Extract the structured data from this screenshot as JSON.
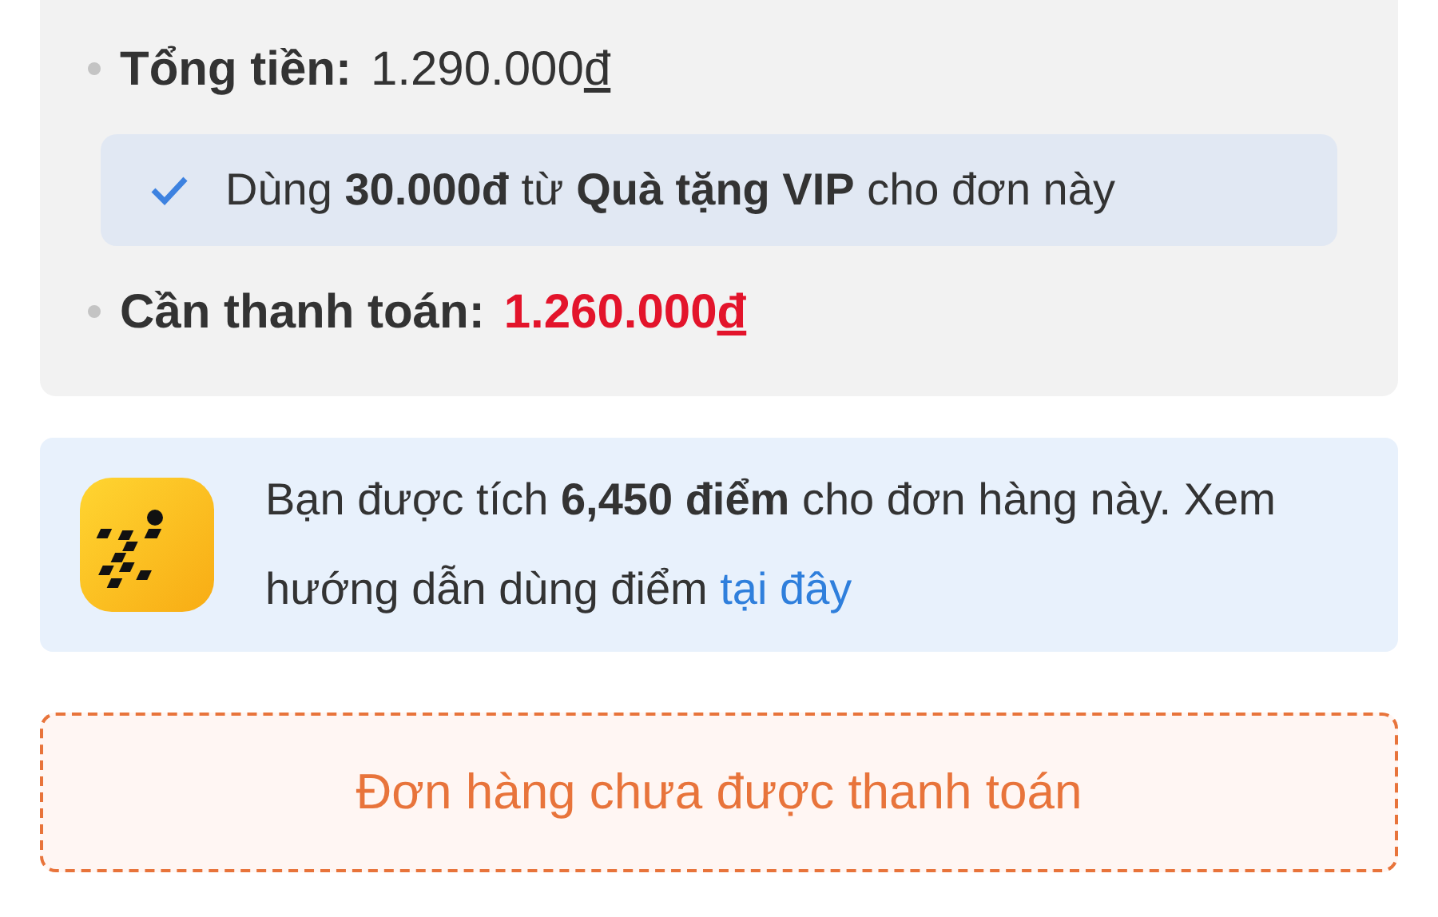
{
  "summary": {
    "total": {
      "label": "Tổng tiền:",
      "amount": "1.290.000",
      "currency": "đ"
    },
    "voucher": {
      "checked": true,
      "text": "Dùng **30.000đ** từ **Quà tặng VIP** cho đơn này"
    },
    "payable": {
      "label": "Cần thanh toán:",
      "amount": "1.260.000",
      "currency": "đ"
    }
  },
  "points": {
    "text": "Bạn được tích **6,450 điểm** cho đơn hàng này. Xem hướng dẫn dùng điểm",
    "link": "tại đây"
  },
  "status": {
    "text": "Đơn hàng chưa được thanh toán"
  }
}
